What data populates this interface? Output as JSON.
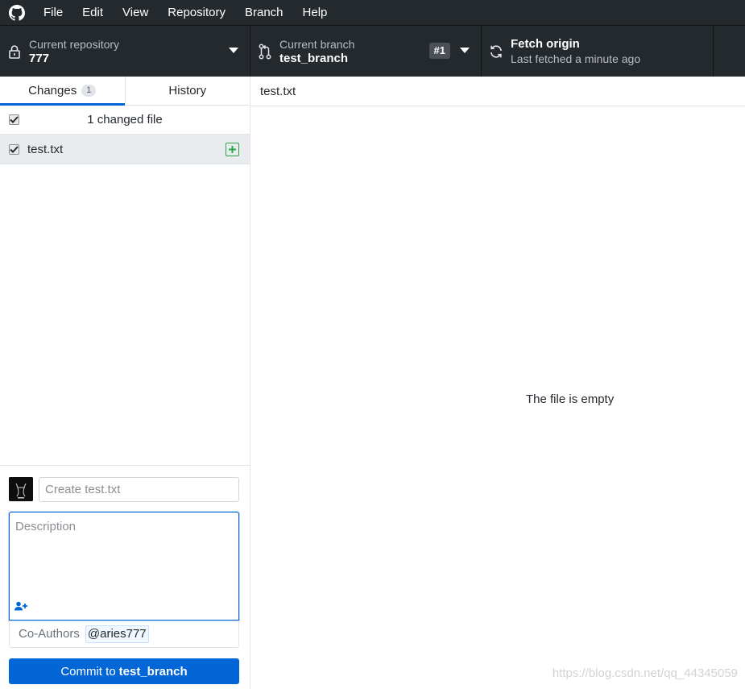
{
  "app": {
    "icon": "github-octocat-icon"
  },
  "menu": {
    "items": [
      "File",
      "Edit",
      "View",
      "Repository",
      "Branch",
      "Help"
    ]
  },
  "toolbar": {
    "repository": {
      "label": "Current repository",
      "value": "777",
      "icon": "lock-icon"
    },
    "branch": {
      "label": "Current branch",
      "value": "test_branch",
      "pr_badge": "#1",
      "icon": "git-pull-request-icon"
    },
    "fetch": {
      "label": "Fetch origin",
      "status": "Last fetched a minute ago",
      "icon": "sync-icon"
    }
  },
  "sidebar": {
    "tabs": [
      {
        "label": "Changes",
        "count": "1",
        "active": true
      },
      {
        "label": "History",
        "active": false
      }
    ],
    "changed_header": "1 changed file",
    "files": [
      {
        "name": "test.txt",
        "status": "added",
        "checked": true
      }
    ]
  },
  "commit": {
    "summary_placeholder": "Create test.txt",
    "description_placeholder": "Description",
    "coauthors_label": "Co-Authors",
    "coauthor": "@aries777",
    "button_prefix": "Commit to",
    "button_branch": "test_branch"
  },
  "diff": {
    "file_name": "test.txt",
    "message": "The file is empty"
  },
  "watermark": "https://blog.csdn.net/qq_44345059",
  "colors": {
    "toolbar_bg": "#24292e",
    "accent": "#0366d6",
    "added": "#28a745"
  }
}
